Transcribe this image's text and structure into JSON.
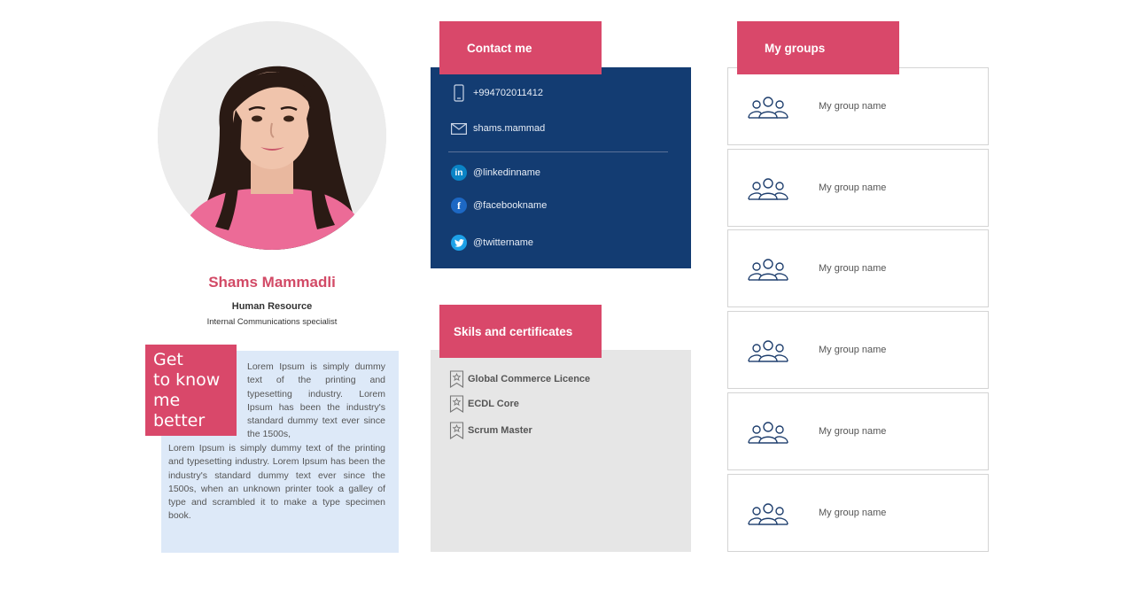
{
  "profile": {
    "name": "Shams Mammadli",
    "department": "Human Resource",
    "title": "Internal Communications specialist"
  },
  "about": {
    "heading": "Get\nto know\nme\nbetter",
    "text_top": "Lorem Ipsum is simply dummy text of the printing and typesetting industry. Lorem Ipsum has been the industry's standard dummy text ever since the 1500s,",
    "text_bottom": "Lorem Ipsum is simply dummy text of the printing and typesetting industry. Lorem Ipsum has been the industry's standard dummy text ever since the 1500s, when an unknown printer took a galley of type and scrambled it to make a type specimen book."
  },
  "contact": {
    "heading": "Contact me",
    "phone": "+994702011412",
    "email": "shams.mammad",
    "linkedin": "@linkedinname",
    "facebook": "@facebookname",
    "twitter": "@twittername",
    "icons": [
      "phone-icon",
      "mail-icon",
      "linkedin-icon",
      "facebook-icon",
      "twitter-icon"
    ]
  },
  "skills": {
    "heading": "Skils and certificates",
    "items": [
      "Global Commerce Licence",
      "ECDL Core",
      "Scrum Master"
    ],
    "icon": "award-ribbon-icon"
  },
  "groups": {
    "heading": "My groups",
    "items": [
      "My group name",
      "My group name",
      "My group name",
      "My group name",
      "My group name",
      "My group name"
    ],
    "icon": "people-group-icon"
  },
  "colors": {
    "accent": "#d9486a",
    "name": "#d24a66",
    "contact_bg": "#133c72",
    "about_bg": "#dde9f8",
    "skills_bg": "#e6e6e6",
    "linkedin": "#0a84c6",
    "facebook": "#1d68c4",
    "twitter": "#1da1e8"
  }
}
